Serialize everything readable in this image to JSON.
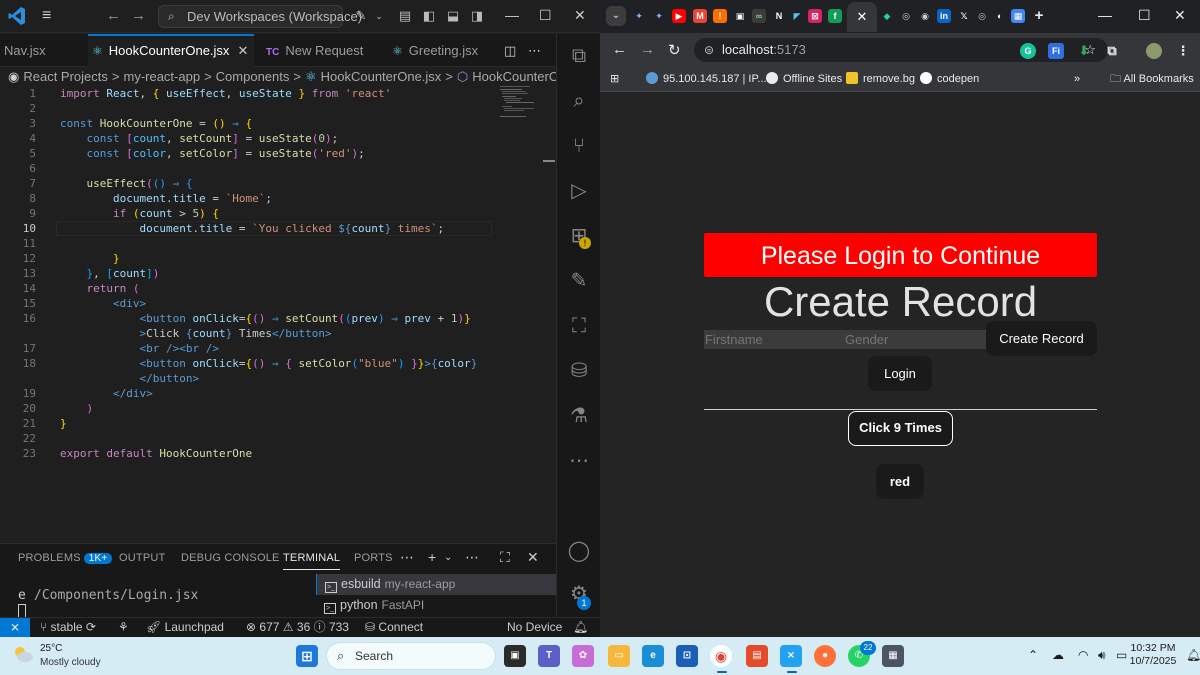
{
  "vscode": {
    "search_text": "Dev Workspaces (Workspace)",
    "tabs": [
      {
        "label": "Nav.jsx",
        "icon": ""
      },
      {
        "label": "HookCounterOne.jsx",
        "icon": "react-icon"
      },
      {
        "label": "New Request",
        "icon": "TC"
      },
      {
        "label": "Greeting.jsx",
        "icon": "react-icon"
      }
    ],
    "breadcrumb": [
      "React Projects",
      ">",
      "my-react-app",
      ">",
      "Components",
      ">",
      "HookCounterOne.jsx",
      ">",
      "HookCounterOne"
    ],
    "line_numbers": [
      "1",
      "2",
      "3",
      "4",
      "5",
      "6",
      "7",
      "8",
      "9",
      "10",
      "11",
      "12",
      "13",
      "14",
      "15",
      "16",
      "",
      "17",
      "18",
      "",
      "19",
      "20",
      "21",
      "22",
      "23"
    ],
    "panel": {
      "tabs": [
        "PROBLEMS",
        "OUTPUT",
        "DEBUG CONSOLE",
        "TERMINAL",
        "PORTS"
      ],
      "problems_badge": "1K+",
      "terminal_text": "/Components/Login.jsx",
      "terminal_prefix": "e",
      "terminals": [
        {
          "name": "esbuild",
          "sub": "my-react-app"
        },
        {
          "name": "python",
          "sub": "FastAPI"
        }
      ]
    },
    "status": {
      "branch": "stable",
      "launchpad": "Launchpad",
      "errors": "677",
      "warnings": "36",
      "info": "733",
      "connect": "Connect",
      "device": "No Device"
    },
    "settings_badge": "1"
  },
  "chrome": {
    "url_host": "localhost",
    "url_port": ":5173",
    "bookmarks": [
      "95.100.145.187 | IP...",
      "Offline Sites",
      "remove.bg",
      "codepen"
    ],
    "all_bookmarks": "All Bookmarks",
    "page": {
      "banner": "Please Login to Continue",
      "title": "Create Record",
      "firstname_placeholder": "Firstname",
      "gender_placeholder": "Gender",
      "create_button": "Create Record",
      "login_button": "Login",
      "click_button": "Click 9 Times",
      "color_button": "red"
    }
  },
  "taskbar": {
    "temperature": "25°C",
    "weather": "Mostly cloudy",
    "search_placeholder": "Search",
    "time": "10:32 PM",
    "date": "10/7/2025",
    "whatsapp_badge": "22"
  },
  "colors": {
    "accent": "#0078d4",
    "banner_red": "#ff0000",
    "editor_bg": "#1f1f1f",
    "page_bg": "#242424"
  }
}
